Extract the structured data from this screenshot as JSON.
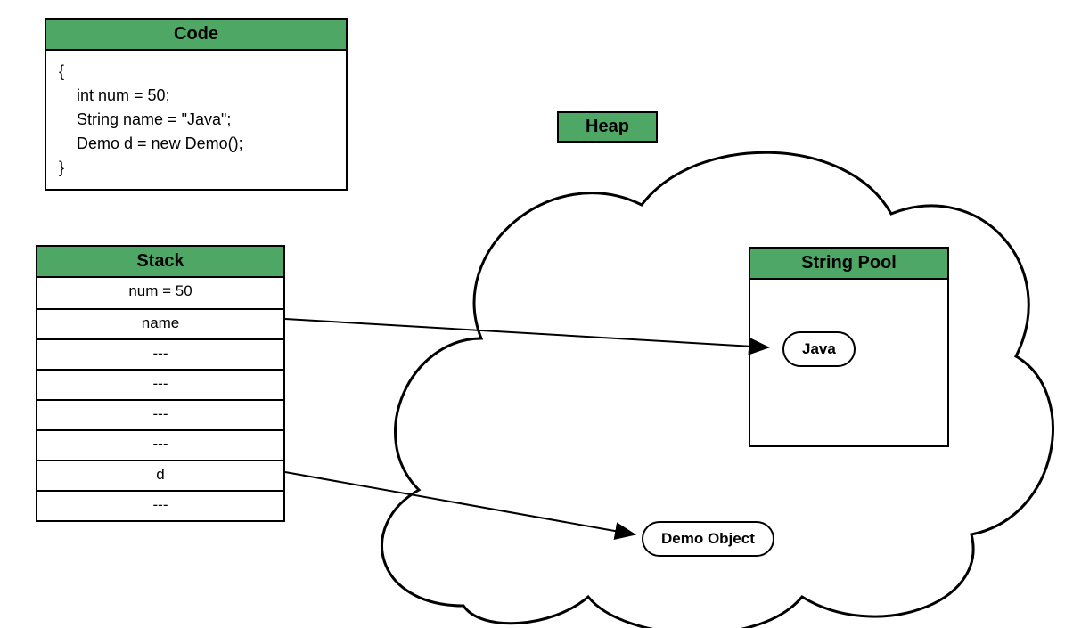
{
  "code": {
    "title": "Code",
    "body": "{\n    int num = 50;\n    String name = \"Java\";\n    Demo d = new Demo();\n}"
  },
  "stack": {
    "title": "Stack",
    "rows": [
      "num = 50",
      "name",
      "---",
      "---",
      "---",
      "---",
      "d",
      "---"
    ]
  },
  "heap": {
    "label": "Heap",
    "stringPool": {
      "title": "String Pool",
      "value": "Java"
    },
    "demoObject": "Demo Object"
  }
}
